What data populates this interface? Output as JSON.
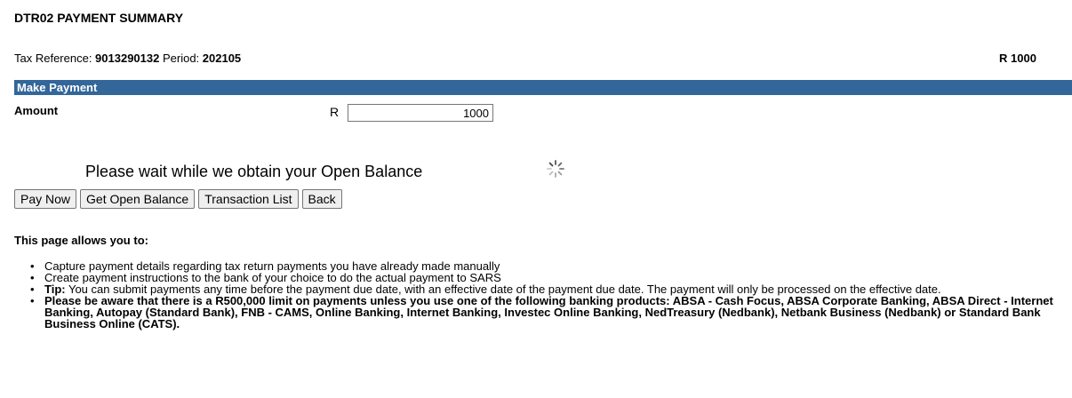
{
  "page": {
    "title": "DTR02 PAYMENT SUMMARY"
  },
  "reference": {
    "tax_label": "Tax Reference: ",
    "tax_value": "9013290132",
    "period_label": " Period: ",
    "period_value": "202105",
    "amount": "R 1000"
  },
  "section": {
    "title": "Make Payment"
  },
  "payment": {
    "amount_label": "Amount",
    "currency": "R",
    "amount_value": "1000"
  },
  "status": {
    "wait_message": "Please wait while we obtain your Open Balance",
    "spinner_icon": "loading-spinner-icon"
  },
  "buttons": {
    "pay_now": "Pay Now",
    "get_open_balance": "Get Open Balance",
    "transaction_list": "Transaction List",
    "back": "Back"
  },
  "info": {
    "intro": "This page allows you to:",
    "bullet1": "Capture payment details regarding tax return payments you have already made manually",
    "bullet2": "Create payment instructions to the bank of your choice to do the actual payment to SARS",
    "tip_label": "Tip:",
    "tip_text": " You can submit payments any time before the payment due date, with an effective date of the payment due date. The payment will only be processed on the effective date.",
    "bullet4": "Please be aware that there is a R500,000 limit on payments unless you use one of the following banking products: ABSA - Cash Focus, ABSA Corporate Banking, ABSA Direct - Internet Banking, Autopay (Standard Bank), FNB - CAMS, Online Banking, Internet Banking, Investec Online Banking, NedTreasury (Nedbank), Netbank Business (Nedbank) or Standard Bank Business Online (CATS)."
  },
  "colors": {
    "section_bar": "#336699"
  }
}
